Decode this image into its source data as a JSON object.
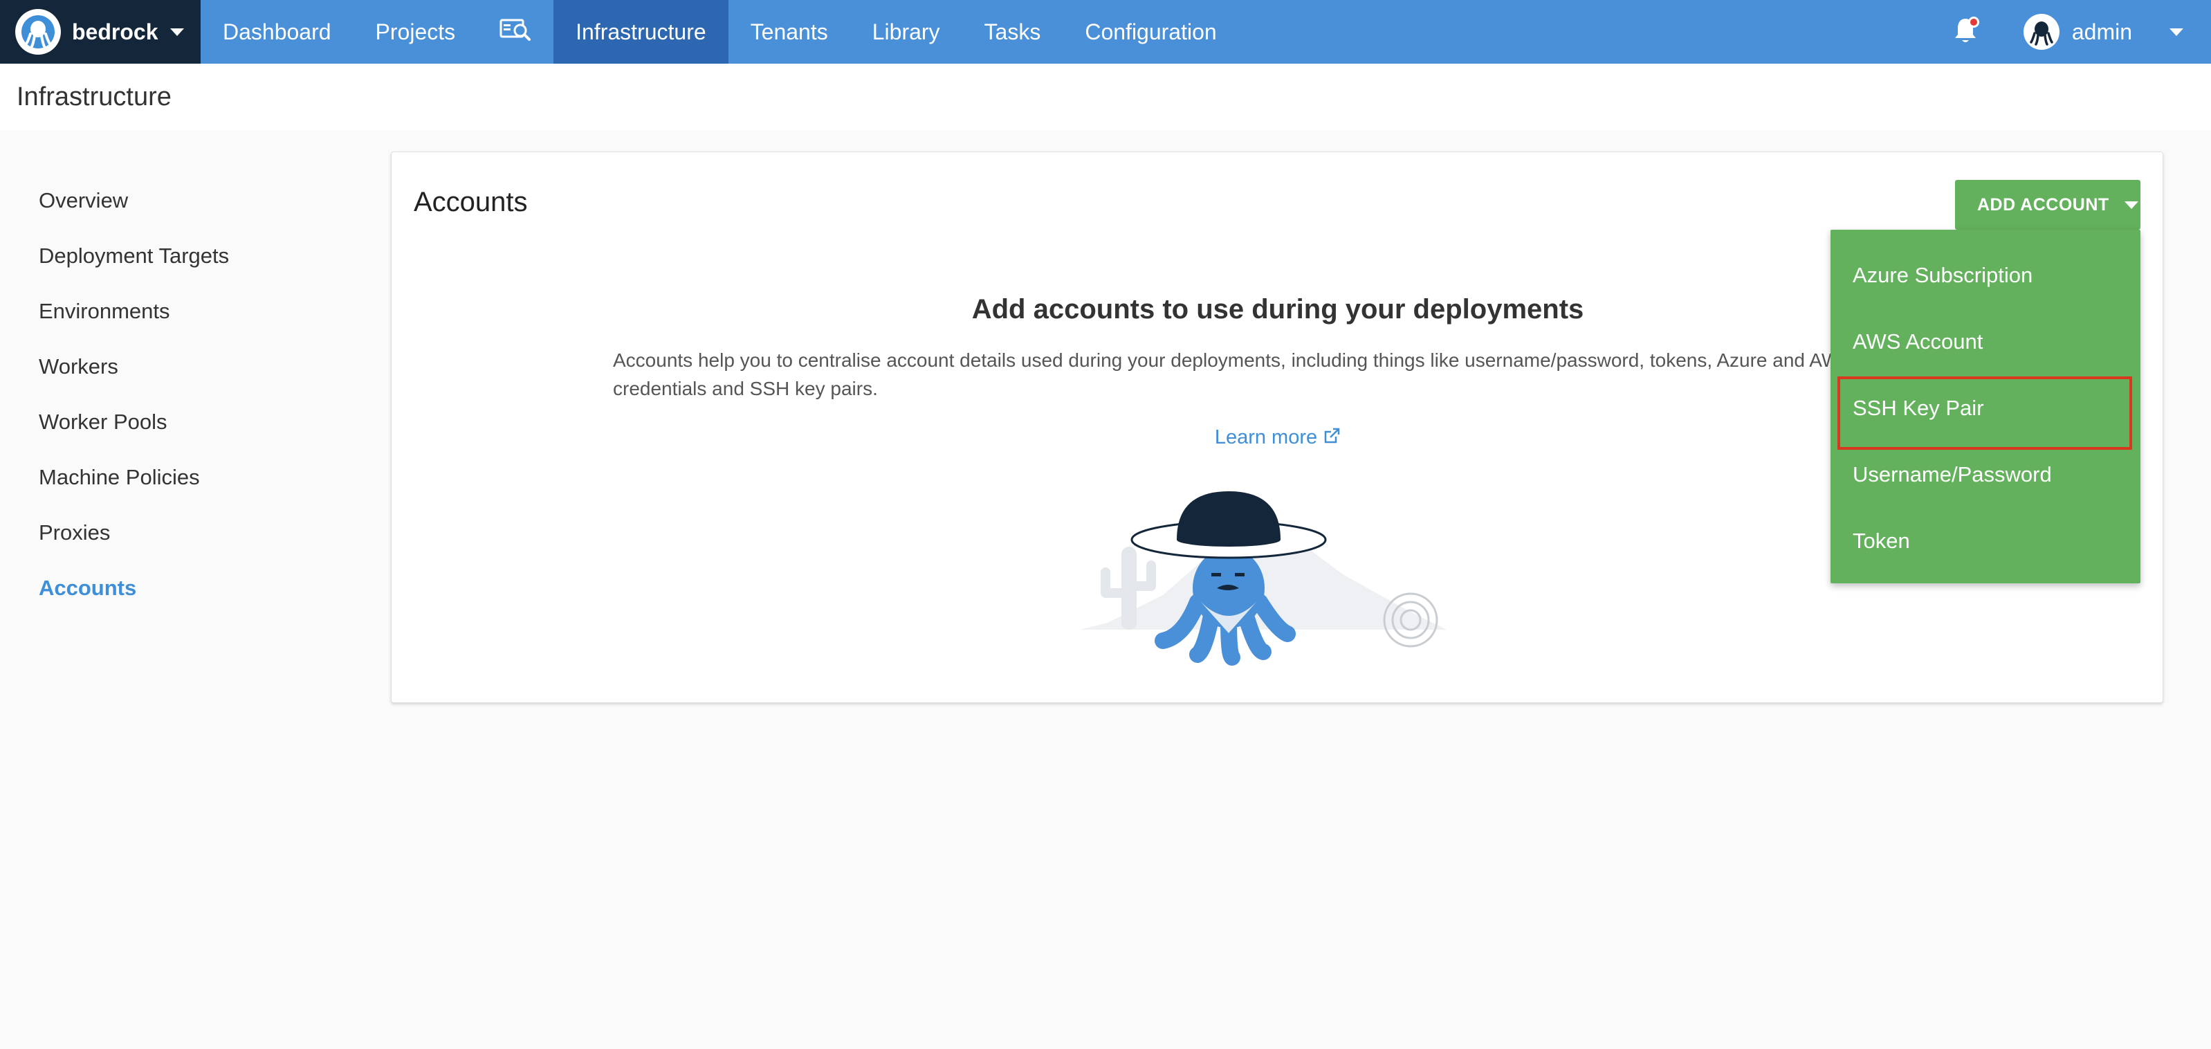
{
  "topnav": {
    "space_name": "bedrock",
    "items": [
      {
        "label": "Dashboard"
      },
      {
        "label": "Projects"
      },
      {
        "label": "Infrastructure",
        "active": true
      },
      {
        "label": "Tenants"
      },
      {
        "label": "Library"
      },
      {
        "label": "Tasks"
      },
      {
        "label": "Configuration"
      }
    ],
    "user_name": "admin"
  },
  "page": {
    "title": "Infrastructure"
  },
  "sidebar": {
    "items": [
      {
        "label": "Overview"
      },
      {
        "label": "Deployment Targets"
      },
      {
        "label": "Environments"
      },
      {
        "label": "Workers"
      },
      {
        "label": "Worker Pools"
      },
      {
        "label": "Machine Policies"
      },
      {
        "label": "Proxies"
      },
      {
        "label": "Accounts",
        "active": true
      }
    ]
  },
  "main": {
    "title": "Accounts",
    "add_button": "ADD ACCOUNT",
    "empty_title": "Add accounts to use during your deployments",
    "empty_body": "Accounts help you to centralise account details used during your deployments, including things like username/password, tokens, Azure and AWS credentials and SSH key pairs.",
    "learn_more": "Learn more"
  },
  "dropdown": {
    "items": [
      {
        "label": "Azure Subscription"
      },
      {
        "label": "AWS Account"
      },
      {
        "label": "SSH Key Pair",
        "highlighted": true
      },
      {
        "label": "Username/Password"
      },
      {
        "label": "Token"
      }
    ]
  },
  "colors": {
    "nav_bg": "#4a90d9",
    "nav_active": "#2e67b1",
    "space_bg": "#14273a",
    "accent_green": "#63b15d",
    "link_blue": "#3e8fd8",
    "highlight_red": "#d9381e"
  }
}
